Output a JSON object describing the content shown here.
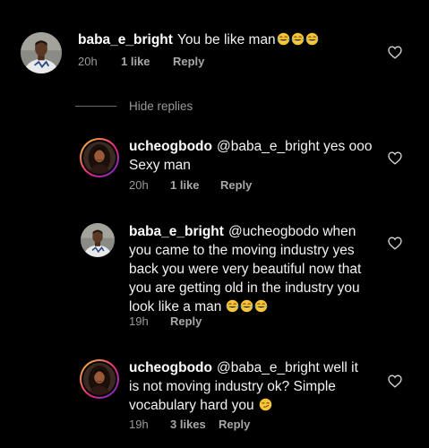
{
  "comments": [
    {
      "username": "baba_e_bright",
      "text": "You be like man",
      "time": "20h",
      "likes": "1 like",
      "reply": "Reply"
    },
    {
      "username": "ucheogbodo",
      "text": "@baba_e_bright yes ooo Sexy man",
      "time": "20h",
      "likes": "1 like",
      "reply": "Reply"
    },
    {
      "username": "baba_e_bright",
      "text": "@ucheogbodo when you came to the moving industry yes back you were very beautiful now that you are getting old in the industry you look like a man",
      "time": "19h",
      "likes": "",
      "reply": "Reply"
    },
    {
      "username": "ucheogbodo",
      "text": "@baba_e_bright well it is not moving industry ok? Simple vocabulary hard you",
      "time": "19h",
      "likes": "3 likes",
      "reply": "Reply"
    }
  ],
  "hide_replies": "Hide replies",
  "colors": {
    "background": "#000000",
    "meta_text": "#9a9a9a",
    "story_ring": "#ee2a7b"
  },
  "icons": {
    "like": "heart-outline-icon",
    "laugh": "tears-of-joy-emoji",
    "smirk": "smirk-emoji"
  }
}
